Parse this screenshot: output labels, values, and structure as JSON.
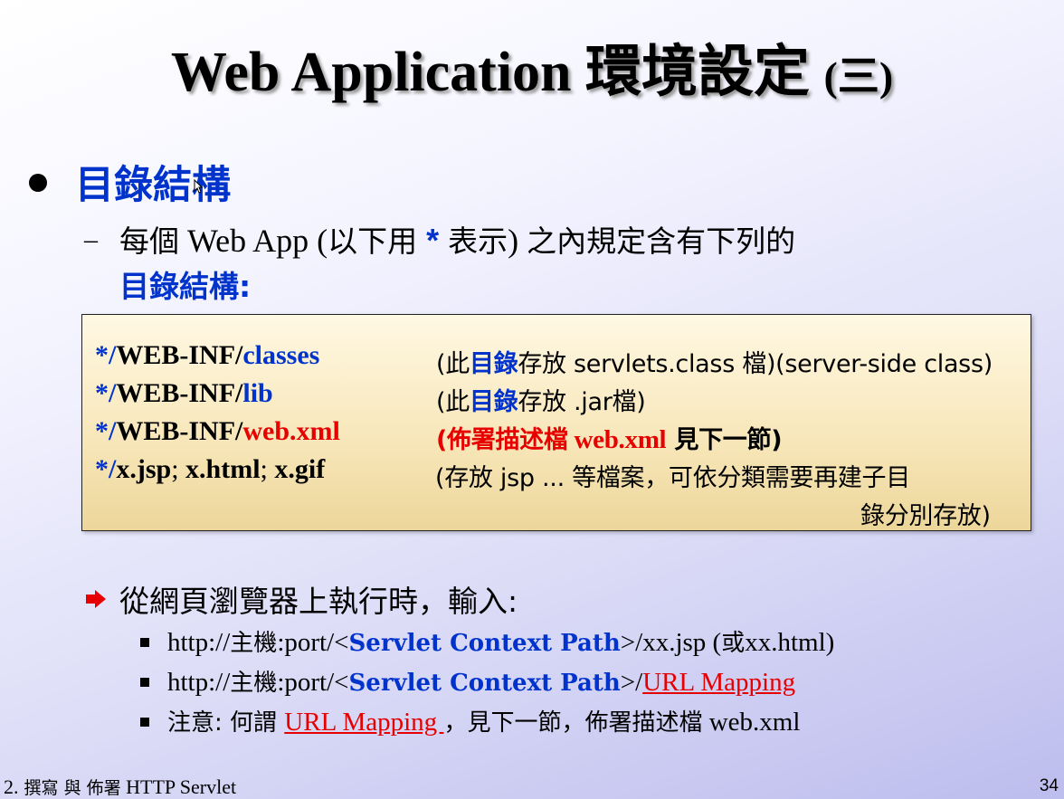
{
  "slide": {
    "title": "Web Application 環境設定",
    "title_suffix": "(三)",
    "heading": "目錄結構",
    "sub_dash": "–",
    "sub_line1": {
      "a": "每個",
      "b": " Web App (",
      "c": "以下用",
      "star": " * ",
      "d": "表示",
      "e": ") ",
      "f": "之內規定含有下列的"
    },
    "sub_line2": "目錄結構:",
    "dir_rows": [
      {
        "path_star": "*/",
        "path_mid": "WEB-INF/",
        "path_tail": "classes",
        "note_a": "(此",
        "note_b": "目錄",
        "note_c": "存放 servlets.class 檔)(server-side class)"
      },
      {
        "path_star": "*/",
        "path_mid": "WEB-INF/",
        "path_tail": "lib",
        "note_a": "(此",
        "note_b": "目錄",
        "note_c": "存放 .jar檔)"
      },
      {
        "path_star": "*/",
        "path_mid": "WEB-INF/",
        "path_tail": "web.xml",
        "note_a": "(",
        "note_b": "佈署描述檔",
        "note_c": " web.xml",
        "note_d": " 見下一節)"
      },
      {
        "path_star": "*/",
        "path_a": "x.jsp",
        "path_sep1": "; ",
        "path_b": "x.html",
        "path_sep2": "; ",
        "path_c": "x.gif",
        "note_a": "(存放 jsp ... 等檔案，可依分類需要再建子目",
        "note_b": "錄分別存放)"
      }
    ],
    "arrow_text": "從網頁瀏覽器上執行時，輸入:",
    "items": [
      {
        "a": "http://",
        "b": "主機",
        "c": ":port/<",
        "d": "Servlet Context Path",
        "e": ">/xx.jsp (",
        "f": "或",
        "g": "xx.html)"
      },
      {
        "a": "http://",
        "b": "主機",
        "c": ":port/<",
        "d": "Servlet Context Path",
        "e": ">/",
        "link": "URL Mapping"
      },
      {
        "a": "注意: 何謂 ",
        "link": "URL Mapping ",
        "b": "，見下一節，佈署描述檔",
        "c": " web.xml"
      }
    ],
    "footer_num": "2.",
    "footer_a": " 撰寫 與 佈署",
    "footer_b": " HTTP Servlet",
    "page_number": "34"
  },
  "colors": {
    "blue": "#0033cc",
    "red": "#e60000",
    "box_bg": "#f7e6b8"
  }
}
